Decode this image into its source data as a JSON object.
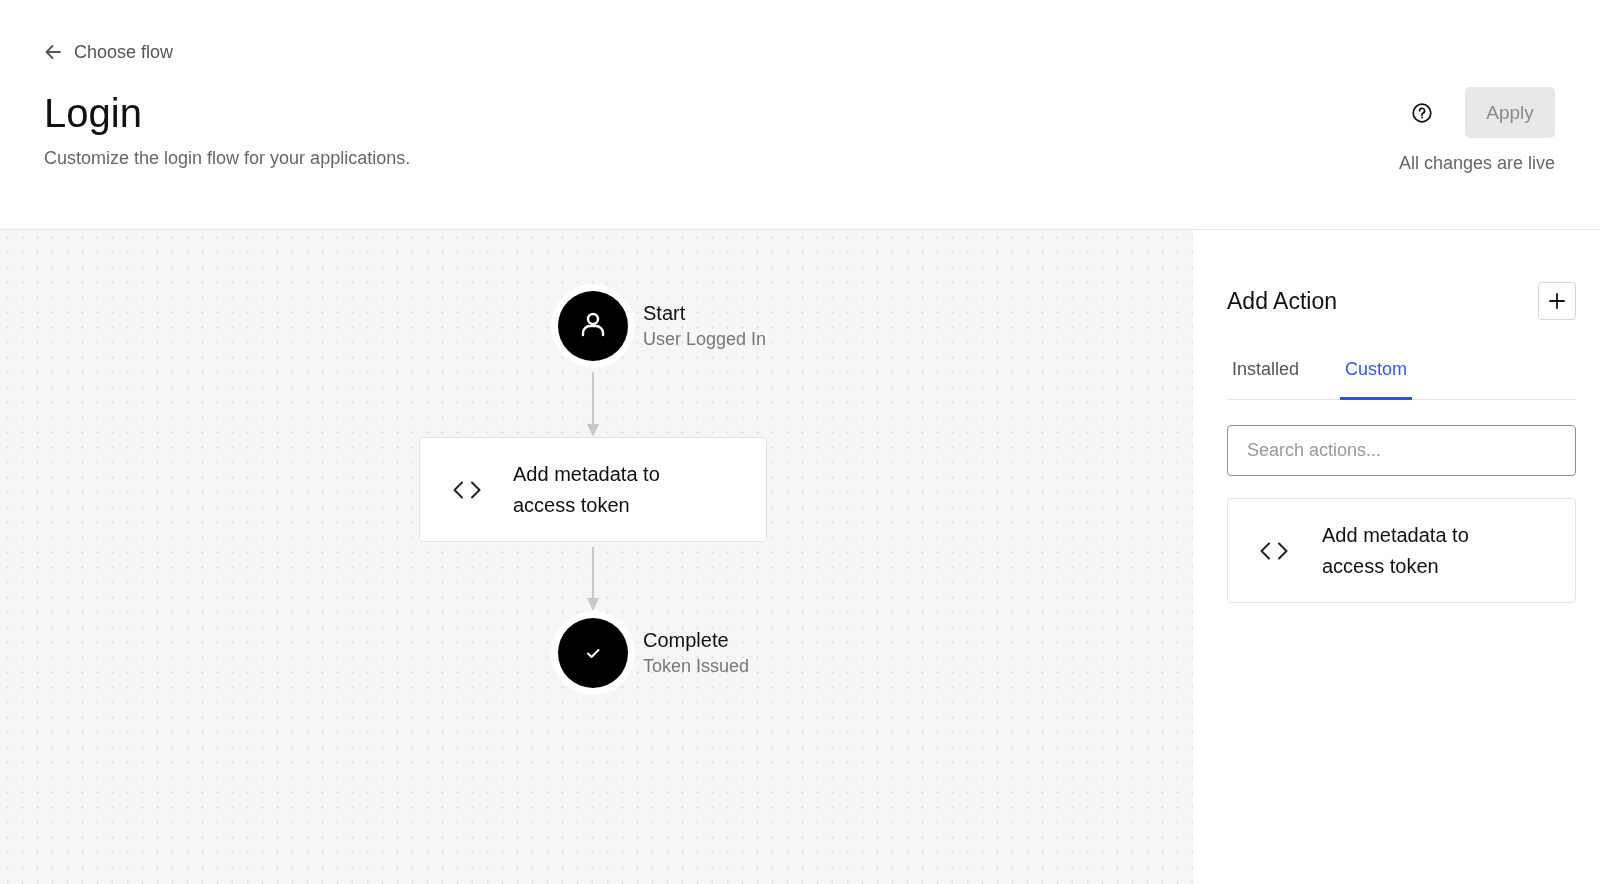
{
  "header": {
    "back_link": "Choose flow",
    "title": "Login",
    "subtitle": "Customize the login flow for your applications.",
    "apply_button": {
      "label": "Apply",
      "disabled": true
    },
    "status": "All changes are live"
  },
  "flow": {
    "nodes": [
      {
        "kind": "trigger",
        "title": "Start",
        "subtitle": "User Logged In"
      },
      {
        "kind": "action",
        "title": "Add metadata to access token"
      },
      {
        "kind": "end",
        "title": "Complete",
        "subtitle": "Token Issued"
      }
    ]
  },
  "panel": {
    "title": "Add Action",
    "tabs": [
      {
        "label": "Installed",
        "selected": false
      },
      {
        "label": "Custom",
        "selected": true
      }
    ],
    "search": {
      "placeholder": "Search actions..."
    },
    "actions": [
      {
        "title": "Add metadata to access token"
      }
    ]
  }
}
